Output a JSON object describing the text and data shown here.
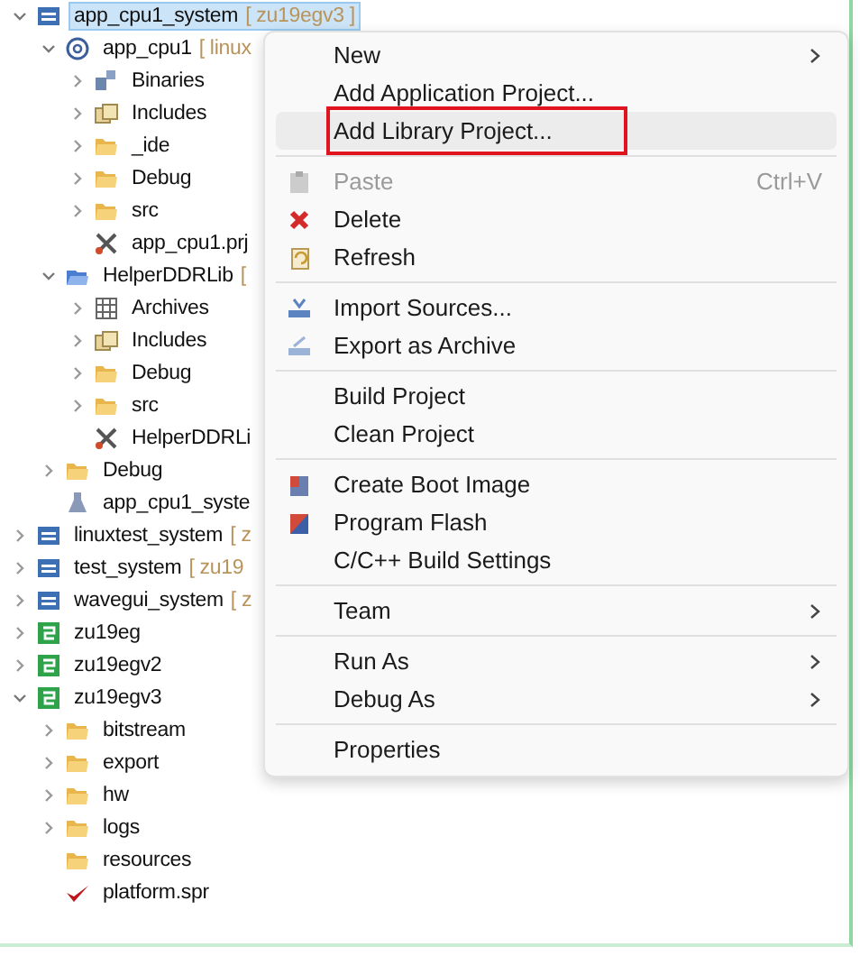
{
  "tree": [
    {
      "label": "app_cpu1_system",
      "decoration": "[ zu19egv3 ]",
      "kind": "system",
      "selected": true,
      "expanded": true,
      "children": [
        {
          "label": "app_cpu1",
          "decoration": "[ linux",
          "kind": "app",
          "selected": false,
          "expanded": true,
          "children": [
            {
              "label": "Binaries",
              "kind": "binaries",
              "selected": false,
              "expanded": false
            },
            {
              "label": "Includes",
              "kind": "includes",
              "selected": false,
              "expanded": false
            },
            {
              "label": "_ide",
              "kind": "folder",
              "selected": false,
              "expanded": false
            },
            {
              "label": "Debug",
              "kind": "folder",
              "selected": false,
              "expanded": false
            },
            {
              "label": "src",
              "kind": "folder",
              "selected": false,
              "expanded": false
            },
            {
              "label": "app_cpu1.prj",
              "kind": "tool-file",
              "selected": false
            }
          ]
        },
        {
          "label": "HelperDDRLib",
          "decoration": "[",
          "kind": "library",
          "selected": false,
          "expanded": true,
          "children": [
            {
              "label": "Archives",
              "kind": "archives",
              "selected": false,
              "expanded": false
            },
            {
              "label": "Includes",
              "kind": "includes",
              "selected": false,
              "expanded": false
            },
            {
              "label": "Debug",
              "kind": "folder",
              "selected": false,
              "expanded": false
            },
            {
              "label": "src",
              "kind": "folder",
              "selected": false,
              "expanded": false
            },
            {
              "label": "HelperDDRLi",
              "kind": "tool-file",
              "selected": false
            }
          ]
        },
        {
          "label": "Debug",
          "kind": "folder",
          "selected": false,
          "expanded": false
        },
        {
          "label": "app_cpu1_syste",
          "kind": "flask",
          "selected": false
        }
      ]
    },
    {
      "label": "linuxtest_system",
      "decoration": "[ z",
      "kind": "system",
      "selected": false,
      "expanded": false
    },
    {
      "label": "test_system",
      "decoration": "[ zu19",
      "kind": "system",
      "selected": false,
      "expanded": false
    },
    {
      "label": "wavegui_system",
      "decoration": "[ z",
      "kind": "system",
      "selected": false,
      "expanded": false
    },
    {
      "label": "zu19eg",
      "kind": "platform",
      "selected": false,
      "expanded": false
    },
    {
      "label": "zu19egv2",
      "kind": "platform",
      "selected": false,
      "expanded": false
    },
    {
      "label": "zu19egv3",
      "kind": "platform",
      "selected": false,
      "expanded": true,
      "children": [
        {
          "label": "bitstream",
          "kind": "folder",
          "selected": false,
          "expanded": false
        },
        {
          "label": "export",
          "kind": "folder",
          "selected": false,
          "expanded": false
        },
        {
          "label": "hw",
          "kind": "folder",
          "selected": false,
          "expanded": false
        },
        {
          "label": "logs",
          "kind": "folder",
          "selected": false,
          "expanded": false
        },
        {
          "label": "resources",
          "kind": "folder",
          "selected": false
        },
        {
          "label": "platform.spr",
          "kind": "check-file",
          "selected": false
        }
      ]
    }
  ],
  "menu": [
    {
      "kind": "item",
      "label": "New",
      "submenu": true,
      "disabled": false,
      "selected": false,
      "outlined": false
    },
    {
      "kind": "item",
      "label": "Add Application Project...",
      "submenu": false,
      "disabled": false,
      "selected": false,
      "outlined": false
    },
    {
      "kind": "item",
      "label": "Add Library Project...",
      "submenu": false,
      "disabled": false,
      "selected": true,
      "outlined": true
    },
    {
      "kind": "separator"
    },
    {
      "kind": "icon-item",
      "label": "Paste",
      "shortcut": "Ctrl+V",
      "submenu": false,
      "disabled": true,
      "selected": false,
      "outlined": false
    },
    {
      "kind": "icon-item",
      "label": "Delete",
      "submenu": false,
      "disabled": false,
      "selected": false,
      "outlined": false
    },
    {
      "kind": "icon-item",
      "label": "Refresh",
      "submenu": false,
      "disabled": false,
      "selected": false,
      "outlined": false
    },
    {
      "kind": "separator"
    },
    {
      "kind": "icon-item",
      "label": "Import Sources...",
      "submenu": false,
      "disabled": false,
      "selected": false,
      "outlined": false
    },
    {
      "kind": "icon-item",
      "label": "Export as Archive",
      "submenu": false,
      "disabled": false,
      "selected": false,
      "outlined": false
    },
    {
      "kind": "separator"
    },
    {
      "kind": "item",
      "label": "Build Project",
      "submenu": false,
      "disabled": false,
      "selected": false,
      "outlined": false
    },
    {
      "kind": "item",
      "label": "Clean Project",
      "submenu": false,
      "disabled": false,
      "selected": false,
      "outlined": false
    },
    {
      "kind": "separator"
    },
    {
      "kind": "icon-item",
      "label": "Create Boot Image",
      "submenu": false,
      "disabled": false,
      "selected": false,
      "outlined": false
    },
    {
      "kind": "icon-item",
      "label": "Program Flash",
      "submenu": false,
      "disabled": false,
      "selected": false,
      "outlined": false
    },
    {
      "kind": "item",
      "label": "C/C++ Build Settings",
      "submenu": false,
      "disabled": false,
      "selected": false,
      "outlined": false
    },
    {
      "kind": "separator"
    },
    {
      "kind": "item",
      "label": "Team",
      "submenu": true,
      "disabled": false,
      "selected": false,
      "outlined": false
    },
    {
      "kind": "separator"
    },
    {
      "kind": "item",
      "label": "Run As",
      "submenu": true,
      "disabled": false,
      "selected": false,
      "outlined": false
    },
    {
      "kind": "item",
      "label": "Debug As",
      "submenu": true,
      "disabled": false,
      "selected": false,
      "outlined": false
    },
    {
      "kind": "separator"
    },
    {
      "kind": "item",
      "label": "Properties",
      "submenu": false,
      "disabled": false,
      "selected": false,
      "outlined": false
    }
  ]
}
